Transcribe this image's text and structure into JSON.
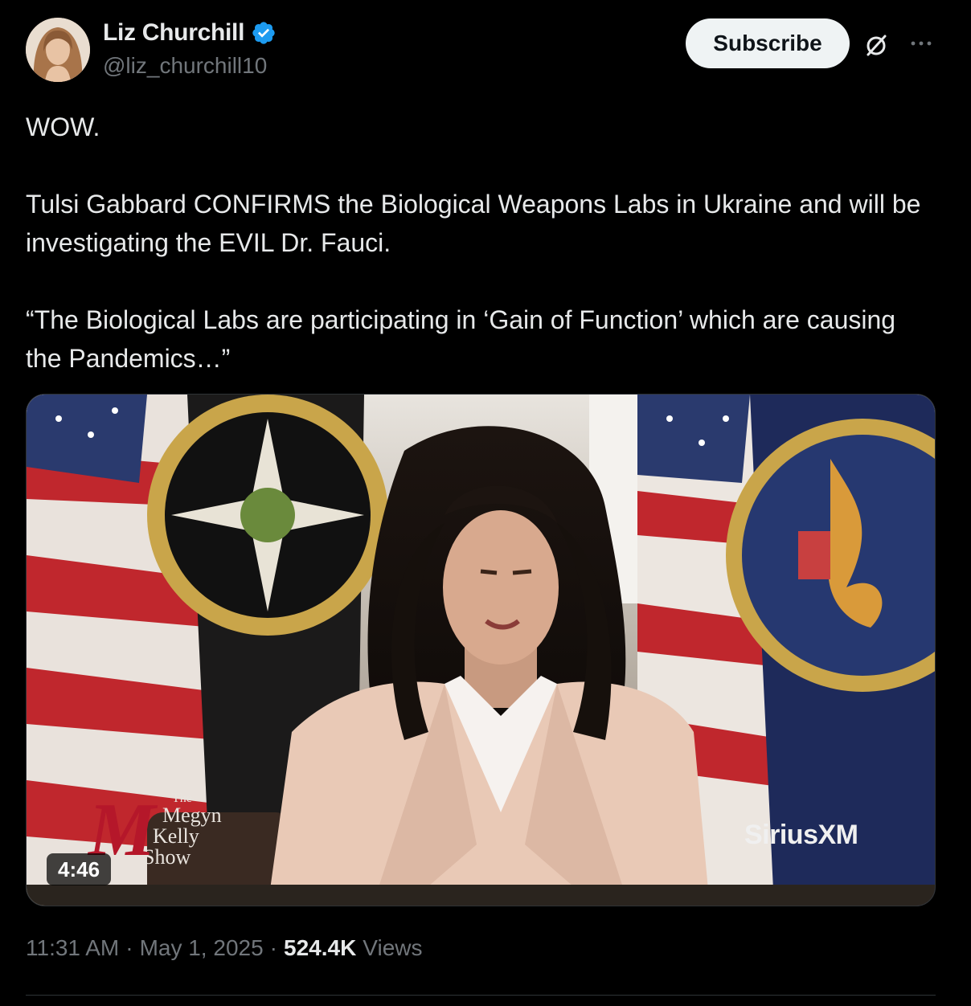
{
  "author": {
    "display_name": "Liz Churchill",
    "handle": "@liz_churchill10",
    "verified": true
  },
  "actions": {
    "subscribe_label": "Subscribe",
    "grok_icon": "grok-slash-circle-icon",
    "more_icon": "more-horizontal-icon"
  },
  "tweet": {
    "line1": "WOW.",
    "line2": "Tulsi Gabbard CONFIRMS the Biological Weapons Labs in Ukraine and will be investigating the EVIL Dr. Fauci.",
    "line3": "“The Biological Labs are participating in ‘Gain of Function’ which are causing the Pandemics…”"
  },
  "media": {
    "duration": "4:46",
    "show_logo": {
      "small": "The",
      "line1": "Megyn",
      "line2": "Kelly",
      "line3": "Show",
      "letter": "M"
    },
    "watermark": "SiriusXM"
  },
  "meta": {
    "time": "11:31 AM",
    "separator": "·",
    "date": "May 1, 2025",
    "views_count": "524.4K",
    "views_label": "Views"
  },
  "colors": {
    "background": "#000000",
    "primary_text": "#e7e9ea",
    "secondary_text": "#71767b",
    "verified_blue": "#1d9bf0",
    "button_bg": "#eff3f4"
  }
}
